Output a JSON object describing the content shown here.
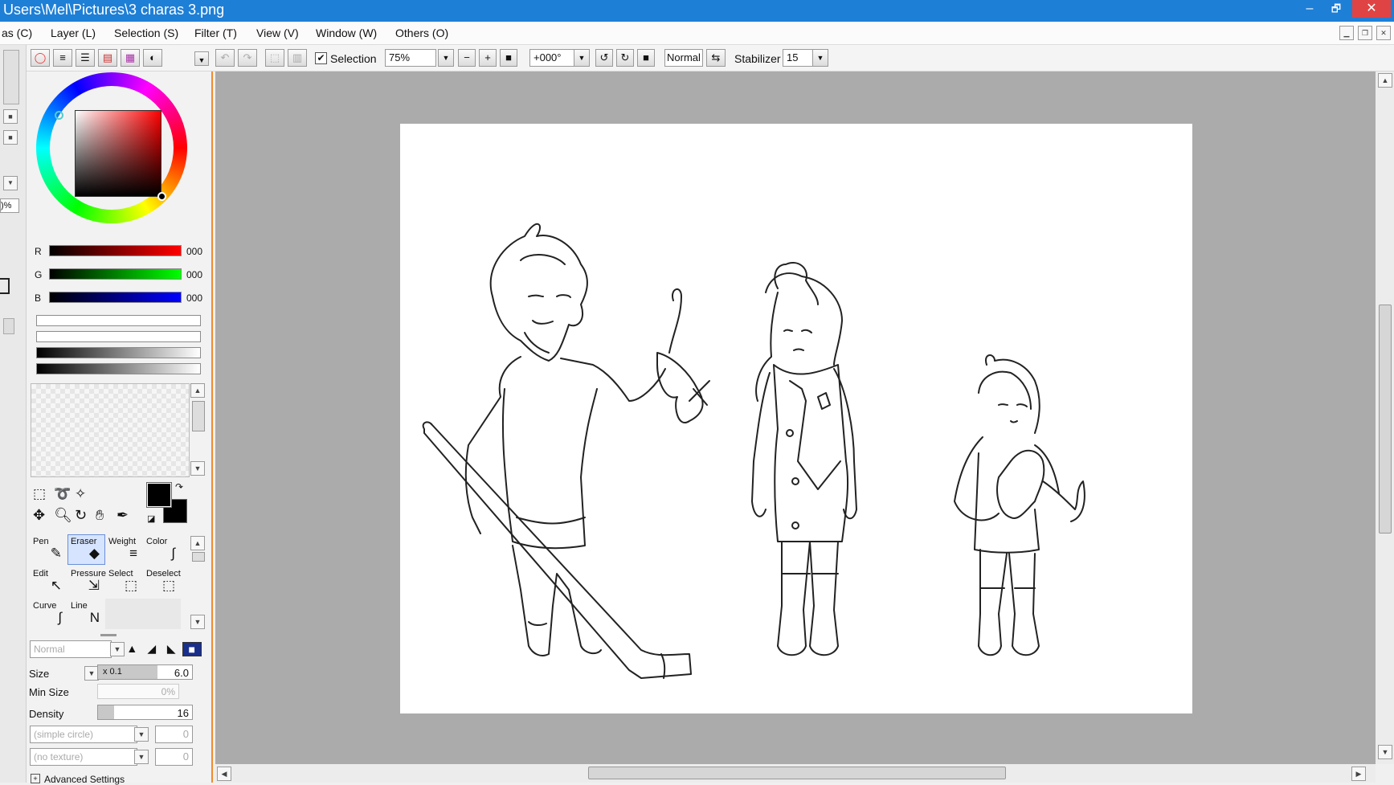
{
  "window": {
    "title": "Users\\Mel\\Pictures\\3 charas 3.png",
    "minimize": "–",
    "restore": "🗗",
    "close": "✕"
  },
  "menu": [
    "as (C)",
    "Layer (L)",
    "Selection (S)",
    "Filter (T)",
    "View (V)",
    "Window (W)",
    "Others (O)"
  ],
  "toolbar": {
    "selection_label": "Selection",
    "zoom": "75%",
    "rotation": "+000°",
    "blend": "Normal",
    "stabilizer_label": "Stabilizer",
    "stabilizer_value": "15"
  },
  "left_strip": {
    "percent": ")%"
  },
  "color": {
    "r_label": "R",
    "g_label": "G",
    "b_label": "B",
    "r_value": "000",
    "g_value": "000",
    "b_value": "000",
    "primary": "#000000",
    "secondary": "#000000"
  },
  "brush_tools": [
    {
      "label": "Pen",
      "icon": "pen-icon",
      "glyph": "✎"
    },
    {
      "label": "Eraser",
      "icon": "eraser-icon",
      "glyph": "◆",
      "selected": true
    },
    {
      "label": "Weight",
      "icon": "weight-icon",
      "glyph": "≡"
    },
    {
      "label": "Color",
      "icon": "color-icon",
      "glyph": "∫"
    },
    {
      "label": "Edit",
      "icon": "edit-icon",
      "glyph": "↖"
    },
    {
      "label": "Pressure",
      "icon": "pressure-icon",
      "glyph": "⇲"
    },
    {
      "label": "Select",
      "icon": "select-icon",
      "glyph": "⬚"
    },
    {
      "label": "Deselect",
      "icon": "deselect-icon",
      "glyph": "⬚"
    },
    {
      "label": "Curve",
      "icon": "curve-icon",
      "glyph": "∫"
    },
    {
      "label": "Line",
      "icon": "line-icon",
      "glyph": "N"
    }
  ],
  "brush": {
    "blend": "Normal",
    "size_label": "Size",
    "size_mult": "x 0.1",
    "size_value": "6.0",
    "minsize_label": "Min Size",
    "minsize_value": "0%",
    "density_label": "Density",
    "density_value": "16",
    "shape": "(simple circle)",
    "shape_value": "0",
    "texture": "(no texture)",
    "texture_value": "0",
    "advanced": "Advanced Settings"
  }
}
